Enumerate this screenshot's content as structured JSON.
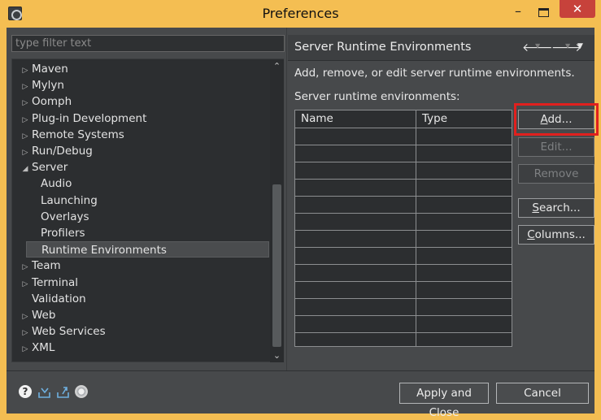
{
  "window": {
    "title": "Preferences",
    "app_icon": "eclipse-icon",
    "controls": {
      "minimize": "–",
      "maximize": "□",
      "close": "✕"
    }
  },
  "sidebar": {
    "filter_placeholder": "type filter text",
    "items": [
      {
        "label": "Maven",
        "expander": "collapsed",
        "indent": 0
      },
      {
        "label": "Mylyn",
        "expander": "collapsed",
        "indent": 0
      },
      {
        "label": "Oomph",
        "expander": "collapsed",
        "indent": 0
      },
      {
        "label": "Plug-in Development",
        "expander": "collapsed",
        "indent": 0
      },
      {
        "label": "Remote Systems",
        "expander": "collapsed",
        "indent": 0
      },
      {
        "label": "Run/Debug",
        "expander": "collapsed",
        "indent": 0
      },
      {
        "label": "Server",
        "expander": "expanded",
        "indent": 0
      },
      {
        "label": "Audio",
        "expander": "none",
        "indent": 1
      },
      {
        "label": "Launching",
        "expander": "none",
        "indent": 1
      },
      {
        "label": "Overlays",
        "expander": "none",
        "indent": 1
      },
      {
        "label": "Profilers",
        "expander": "none",
        "indent": 1
      },
      {
        "label": "Runtime Environments",
        "expander": "none",
        "indent": 1,
        "selected": true
      },
      {
        "label": "Team",
        "expander": "collapsed",
        "indent": 0
      },
      {
        "label": "Terminal",
        "expander": "collapsed",
        "indent": 0
      },
      {
        "label": "Validation",
        "expander": "none",
        "indent": 0
      },
      {
        "label": "Web",
        "expander": "collapsed",
        "indent": 0
      },
      {
        "label": "Web Services",
        "expander": "collapsed",
        "indent": 0
      },
      {
        "label": "XML",
        "expander": "collapsed",
        "indent": 0
      }
    ]
  },
  "page": {
    "title": "Server Runtime Environments",
    "description": "Add, remove, or edit server runtime environments.",
    "list_label": "Server runtime environments:",
    "table": {
      "columns": [
        "Name",
        "Type"
      ],
      "rows": []
    },
    "buttons": {
      "add": {
        "label": "Add...",
        "mnemonic": "A",
        "rest": "dd...",
        "enabled": true
      },
      "edit": {
        "label": "Edit...",
        "enabled": false
      },
      "remove": {
        "label": "Remove",
        "enabled": false
      },
      "search": {
        "label": "Search...",
        "mnemonic": "S",
        "rest": "earch...",
        "enabled": true
      },
      "columns": {
        "label": "Columns...",
        "mnemonic": "C",
        "rest": "olumns...",
        "enabled": true
      }
    },
    "highlight_color": "#e1201e"
  },
  "footer": {
    "icons": [
      "help-icon",
      "import-icon",
      "export-icon",
      "oomph-icon"
    ],
    "apply_close": "Apply and Close",
    "cancel": "Cancel"
  }
}
